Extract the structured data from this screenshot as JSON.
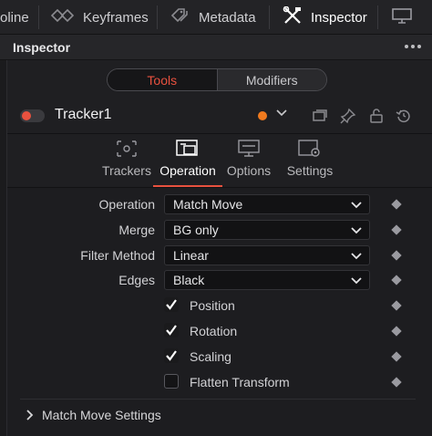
{
  "top_tabs": [
    {
      "label": "oline"
    },
    {
      "label": "Keyframes",
      "icon": "keyframes-icon"
    },
    {
      "label": "Metadata",
      "icon": "metadata-tags-icon"
    },
    {
      "label": "Inspector",
      "icon": "inspector-tools-icon",
      "active": true
    },
    {
      "icon": "viewer-monitor-icon"
    }
  ],
  "panel": {
    "title": "Inspector",
    "menu_icon": "more-dots-icon"
  },
  "mode_tabs": {
    "tools": "Tools",
    "modifiers": "Modifiers",
    "active": "Tools"
  },
  "node": {
    "name": "Tracker1",
    "enabled": true,
    "color": "#f07a1e",
    "icons": [
      "versions-icon",
      "pin-icon",
      "lock-icon",
      "reset-icon"
    ]
  },
  "sub_tabs": [
    {
      "label": "Trackers",
      "icon": "trackers-icon"
    },
    {
      "label": "Operation",
      "icon": "operation-icon",
      "active": true
    },
    {
      "label": "Options",
      "icon": "options-monitor-icon"
    },
    {
      "label": "Settings",
      "icon": "settings-gear-icon"
    }
  ],
  "fields": {
    "operation": {
      "label": "Operation",
      "value": "Match Move"
    },
    "merge": {
      "label": "Merge",
      "value": "BG only"
    },
    "filter_method": {
      "label": "Filter Method",
      "value": "Linear"
    },
    "edges": {
      "label": "Edges",
      "value": "Black"
    }
  },
  "checkboxes": {
    "position": {
      "label": "Position",
      "checked": true
    },
    "rotation": {
      "label": "Rotation",
      "checked": true
    },
    "scaling": {
      "label": "Scaling",
      "checked": true
    },
    "flatten_transform": {
      "label": "Flatten Transform",
      "checked": false
    }
  },
  "sections": {
    "match_move_settings": {
      "title": "Match Move Settings",
      "expanded": false
    }
  },
  "colors": {
    "accent": "#e8513f",
    "background": "#1f1f22",
    "field_bg": "#121214"
  }
}
